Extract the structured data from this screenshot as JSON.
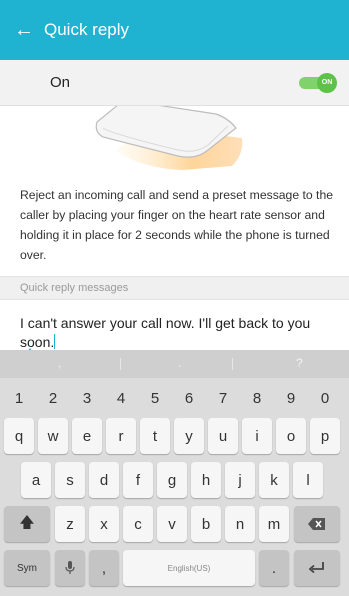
{
  "appbar": {
    "title": "Quick reply",
    "back_icon": "arrow-left-icon"
  },
  "master_toggle": {
    "label": "On",
    "switch_text": "ON",
    "checked": true
  },
  "description": "Reject an incoming call and send a preset message to the caller by placing your finger on the heart rate sensor and holding it in place for 2 seconds while the phone is turned over.",
  "messages_section": {
    "header": "Quick reply messages",
    "message_text": "I can't answer your call now. I'll get back to you soon."
  },
  "suggestions": [
    ",",
    ".",
    "?"
  ],
  "keyboard": {
    "number_row": [
      "1",
      "2",
      "3",
      "4",
      "5",
      "6",
      "7",
      "8",
      "9",
      "0"
    ],
    "row1": [
      "q",
      "w",
      "e",
      "r",
      "t",
      "y",
      "u",
      "i",
      "o",
      "p"
    ],
    "row2": [
      "a",
      "s",
      "d",
      "f",
      "g",
      "h",
      "j",
      "k",
      "l"
    ],
    "row3": [
      "z",
      "x",
      "c",
      "v",
      "b",
      "n",
      "m"
    ],
    "sym_label": "Sym",
    "comma": ",",
    "space_label": "English(US)",
    "period": "."
  },
  "colors": {
    "accent": "#1fb3d1",
    "switch_on": "#5cc248"
  }
}
